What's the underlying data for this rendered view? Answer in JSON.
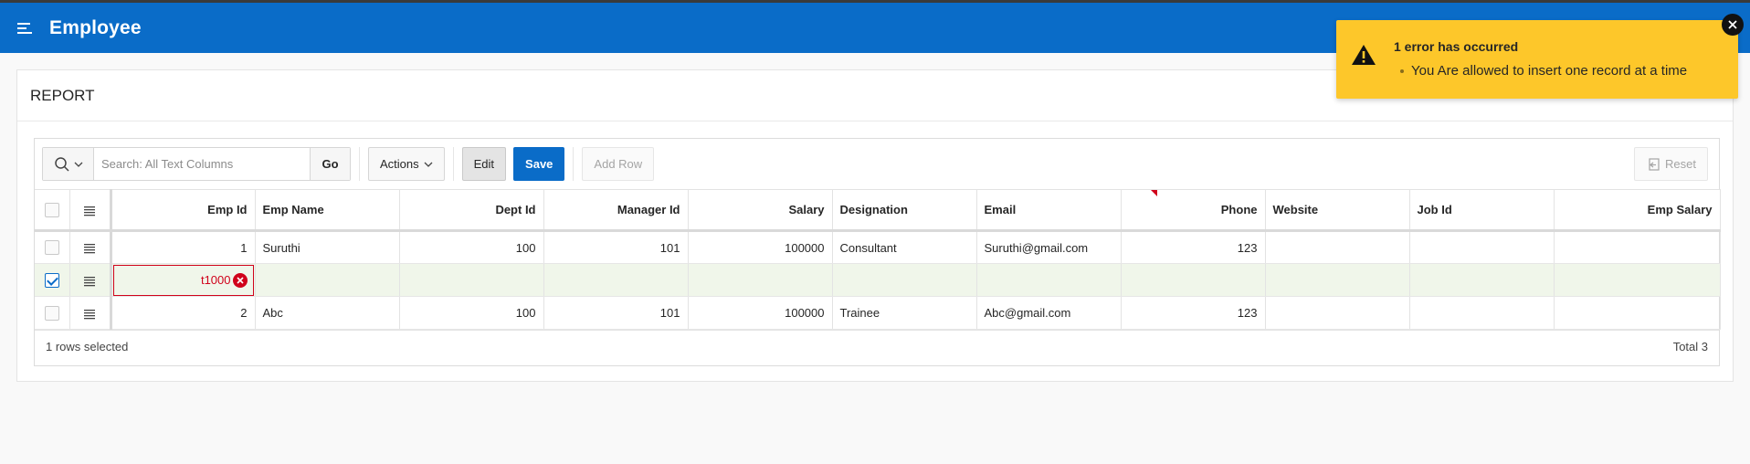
{
  "app": {
    "title": "Employee"
  },
  "region": {
    "title": "REPORT"
  },
  "toolbar": {
    "search_placeholder": "Search: All Text Columns",
    "go_label": "Go",
    "actions_label": "Actions",
    "edit_label": "Edit",
    "save_label": "Save",
    "add_row_label": "Add Row",
    "reset_label": "Reset"
  },
  "grid": {
    "columns": [
      "Emp Id",
      "Emp Name",
      "Dept Id",
      "Manager Id",
      "Salary",
      "Designation",
      "Email",
      "Phone",
      "Website",
      "Job Id",
      "Emp Salary"
    ],
    "rows": [
      {
        "selected": false,
        "emp_id": "1",
        "emp_name": "Suruthi",
        "dept_id": "100",
        "manager_id": "101",
        "salary": "100000",
        "designation": "Consultant",
        "email": "Suruthi@gmail.com",
        "phone": "123",
        "website": "",
        "job_id": "",
        "emp_salary": ""
      },
      {
        "selected": true,
        "emp_id": "t1000",
        "emp_name": "",
        "dept_id": "",
        "manager_id": "",
        "salary": "",
        "designation": "",
        "email": "",
        "phone": "",
        "website": "",
        "job_id": "",
        "emp_salary": ""
      },
      {
        "selected": false,
        "emp_id": "2",
        "emp_name": "Abc",
        "dept_id": "100",
        "manager_id": "101",
        "salary": "100000",
        "designation": "Trainee",
        "email": "Abc@gmail.com",
        "phone": "123",
        "website": "",
        "job_id": "",
        "emp_salary": ""
      }
    ]
  },
  "footer": {
    "selection_text": "1 rows selected",
    "total_text": "Total 3"
  },
  "notification": {
    "title": "1 error has occurred",
    "message": "You Are allowed to insert one record at a time"
  },
  "colors": {
    "header_bg": "#0a6cc8",
    "primary": "#0a6cc8",
    "warning_bg": "#fdc72a",
    "error": "#d0021b",
    "selected_row_bg": "#f0f6ea"
  }
}
